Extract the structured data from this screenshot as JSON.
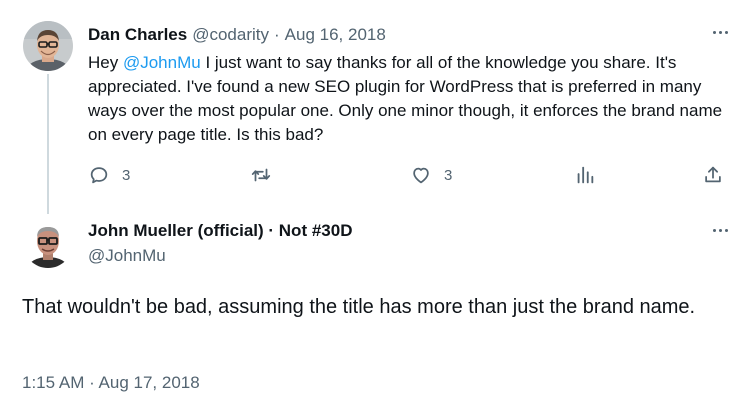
{
  "tweet": {
    "display_name": "Dan Charles",
    "handle": "@codarity",
    "separator": "·",
    "date": "Aug 16, 2018",
    "text_prefix": "Hey ",
    "mention": "@JohnMu",
    "text_body": " I just want to say thanks for all of the knowledge you share. It's appreciated. I've found a new SEO plugin for WordPress that is preferred in many ways over the most popular one. Only one minor though, it enforces the brand name on every page title. Is this bad?",
    "reply_count": "3",
    "like_count": "3",
    "icons": {
      "avatar": "avatar",
      "more": "more-icon",
      "reply": "reply-icon",
      "retweet": "retweet-icon",
      "like": "heart-icon",
      "views": "views-icon",
      "share": "share-icon"
    }
  },
  "reply": {
    "display_name": "John Mueller (official) · Not #30D",
    "handle": "@JohnMu",
    "text": "That wouldn't be bad, assuming the title has more than just the brand name.",
    "timestamp": "1:15 AM · Aug 17, 2018"
  },
  "colors": {
    "text_primary": "#0f1419",
    "text_secondary": "#536471",
    "link": "#1d9bf0",
    "thread_line": "#cfd9de"
  }
}
